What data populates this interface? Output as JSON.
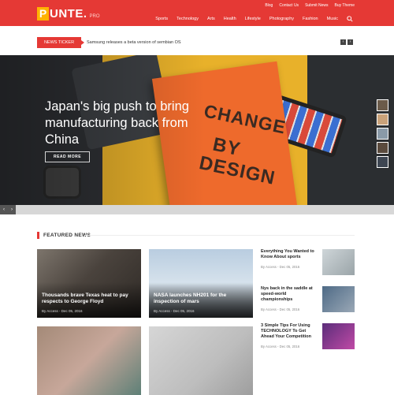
{
  "logo": {
    "first_letter": "P",
    "rest": "UNTE.",
    "suffix": "PRO"
  },
  "top_links": [
    "Blog",
    "Contact Us",
    "Submit News",
    "Buy Theme"
  ],
  "nav": [
    "Sports",
    "Technology",
    "Arts",
    "Health",
    "Lifestyle",
    "Photography",
    "Fashion",
    "Music"
  ],
  "ticker": {
    "label": "NEWS TICKER",
    "text": "Samsung releases a beta version of sembian OS",
    "prev": "‹",
    "next": "›"
  },
  "hero": {
    "title": "Japan's big push to bring manufacturing back from China",
    "button": "READ MORE",
    "book_words": [
      "CHANGE",
      "BY",
      "DESIGN"
    ]
  },
  "slider": {
    "prev": "‹",
    "next": "›"
  },
  "featured": {
    "heading": "FEATURED NEWS",
    "cards": [
      {
        "title": "Thousands brave Texas heat to pay respects to George Floyd",
        "meta": "By Access - Dec 05, 2016"
      },
      {
        "title": "NASA launches NH201 for the inspection of mars",
        "meta": "By Access - Dec 05, 2016"
      },
      {
        "title": "",
        "meta": ""
      },
      {
        "title": "",
        "meta": ""
      }
    ],
    "side": [
      {
        "title": "Everything You Wanted to Know About sports",
        "meta": "By Access - Dec 05, 2016"
      },
      {
        "title": "Nys back in the saddle at speed-world championships",
        "meta": "By Access - Dec 05, 2016"
      },
      {
        "title": "3 Simple Tips For Using TECHNOLOGY To Get Ahead Your Competition",
        "meta": "By Access - Dec 05, 2016"
      }
    ]
  },
  "colors": {
    "accent": "#e53935",
    "logo_box": "#ffb300",
    "book": "#ee6a2c",
    "mat": "#e8b12a"
  }
}
